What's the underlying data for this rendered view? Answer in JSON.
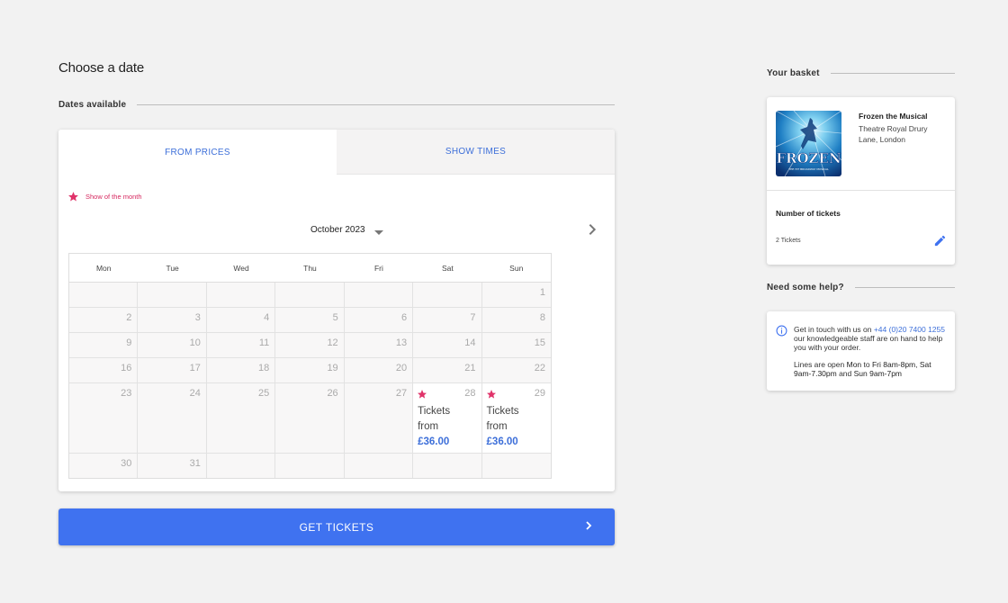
{
  "page": {
    "title": "Choose a date"
  },
  "dates": {
    "section_label": "Dates available",
    "tabs": [
      {
        "label": "FROM PRICES"
      },
      {
        "label": "SHOW TIMES"
      }
    ],
    "legend_label": "Show of the month",
    "month_label": "October 2023",
    "weekdays": [
      "Mon",
      "Tue",
      "Wed",
      "Thu",
      "Fri",
      "Sat",
      "Sun"
    ],
    "weeks": [
      [
        "",
        "",
        "",
        "",
        "",
        "",
        "1"
      ],
      [
        "2",
        "3",
        "4",
        "5",
        "6",
        "7",
        "8"
      ],
      [
        "9",
        "10",
        "11",
        "12",
        "13",
        "14",
        "15"
      ],
      [
        "16",
        "17",
        "18",
        "19",
        "20",
        "21",
        "22"
      ],
      [
        "23",
        "24",
        "25",
        "26",
        "27",
        "28",
        "29"
      ],
      [
        "30",
        "31",
        "",
        "",
        "",
        "",
        ""
      ]
    ],
    "available": {
      "28": {
        "line1": "Tickets",
        "line2": "from",
        "price": "£36.00"
      },
      "29": {
        "line1": "Tickets",
        "line2": "from",
        "price": "£36.00"
      }
    }
  },
  "cta": {
    "label": "GET TICKETS"
  },
  "basket": {
    "section_label": "Your basket",
    "show_title": "Frozen the Musical",
    "venue": "Theatre Royal Drury Lane, London",
    "poster_text": "FROZEN",
    "poster_subtext": "THE HIT BROADWAY MUSICAL",
    "tickets_label": "Number of tickets",
    "tickets_value": "2 Tickets"
  },
  "help": {
    "section_label": "Need some help?",
    "line_prefix": "Get in touch with us on ",
    "phone": "+44 (0)20 7400 1255",
    "line_suffix": " our knowledgeable staff are on hand to help you with your order.",
    "hours_prefix": "Lines are open ",
    "hours_weekday": "Mon",
    "hours_to": " to ",
    "hours_fri": "Fri 8am-8pm",
    "hours_sep": ", ",
    "hours_sat": "Sat 9am-7.30pm",
    "hours_and": " and ",
    "hours_sun": "Sun 9am-7pm"
  },
  "colors": {
    "accent": "#3f72f0",
    "link": "#3d6fd9",
    "star": "#e0336a",
    "background": "#f2f2f2"
  }
}
